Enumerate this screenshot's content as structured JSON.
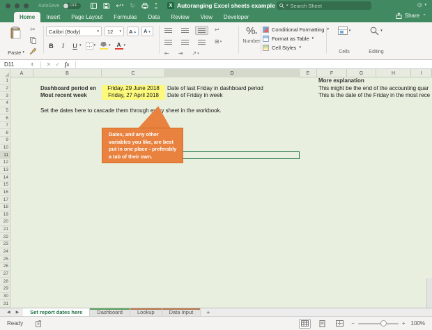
{
  "titlebar": {
    "autosave_label": "AutoSave",
    "autosave_state": "OFF",
    "document_title": "Autoranging Excel sheets example",
    "search_placeholder": "Search Sheet"
  },
  "ribbon_tabs": [
    {
      "label": "Home",
      "active": true
    },
    {
      "label": "Insert"
    },
    {
      "label": "Page Layout"
    },
    {
      "label": "Formulas"
    },
    {
      "label": "Data"
    },
    {
      "label": "Review"
    },
    {
      "label": "View"
    },
    {
      "label": "Developer"
    }
  ],
  "share": {
    "label": "Share"
  },
  "ribbon": {
    "paste_label": "Paste",
    "font_name": "Calibri (Body)",
    "font_size": "12",
    "grow_font": "A",
    "shrink_font": "A",
    "bold": "B",
    "italic": "I",
    "underline": "U",
    "percent": "%",
    "number_label": "Number",
    "conditional_formatting_label": "Conditional Formatting",
    "format_as_table_label": "Format as Table",
    "cell_styles_label": "Cell Styles",
    "cells_label": "Cells",
    "editing_label": "Editing"
  },
  "formula_bar": {
    "name_box": "D11",
    "fx_label": "fx"
  },
  "grid": {
    "columns": [
      "A",
      "B",
      "C",
      "D",
      "E",
      "F",
      "G",
      "H",
      "I"
    ],
    "selected_column": "D",
    "selected_row": 11,
    "row_count": 31,
    "cells": {
      "f1": "More explanation",
      "b2": "Dashboard period en",
      "c2": "Friday, 29 June 2018",
      "d2": "Date of last Friday in dashboard period",
      "f2": "This might be the end of the accounting quar",
      "b3": "Most recent week",
      "c3": "Friday, 27 April 2018",
      "d3": "Date of Friday in week",
      "f3": "This is the date of the Friday in the most rece",
      "b5": "Set the dates here to cascade them through every sheet in the workbook."
    }
  },
  "callout": {
    "text": "Dates, and any other variables you like, are best put in one place - preferably a tab of their own."
  },
  "sheet_tabs": [
    {
      "label": "Set report dates here",
      "active": true
    },
    {
      "label": "Dashboard",
      "accent_top": "#57a05e"
    },
    {
      "label": "Lookup",
      "accent_top": "#b5764a"
    },
    {
      "label": "Data Input",
      "accent_top": "#b5764a"
    },
    {
      "label": "+",
      "add": true
    }
  ],
  "status_bar": {
    "ready_label": "Ready",
    "zoom_out": "−",
    "zoom_in": "+",
    "zoom_level": "100%"
  },
  "colors": {
    "title_green": "#418a61",
    "grid_background": "#e9efdf",
    "highlight_yellow": "#fcf97c",
    "callout_orange": "#e8823e",
    "active_sheet_tab_text": "#217346"
  }
}
